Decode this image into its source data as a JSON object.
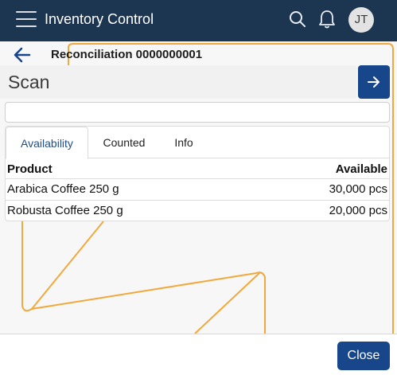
{
  "header": {
    "app_title": "Inventory Control",
    "avatar_initials": "JT",
    "background_color": "#1c3550"
  },
  "document": {
    "title": "Reconciliation 0000000001"
  },
  "scan": {
    "label": "Scan",
    "input_value": "",
    "go_icon": "arrow-right-icon"
  },
  "tabs": [
    {
      "label": "Availability",
      "active": true
    },
    {
      "label": "Counted",
      "active": false
    },
    {
      "label": "Info",
      "active": false
    }
  ],
  "table": {
    "columns": [
      "Product",
      "Available"
    ],
    "rows": [
      {
        "product": "Arabica Coffee 250 g",
        "available": "30,000 pcs"
      },
      {
        "product": "Robusta Coffee 250 g",
        "available": "20,000 pcs"
      }
    ]
  },
  "footer": {
    "close_label": "Close"
  },
  "colors": {
    "accent": "#17468b",
    "decor_line": "#f2a93b"
  },
  "icons": [
    "menu-icon",
    "search-icon",
    "bell-icon",
    "back-arrow-icon",
    "arrow-right-icon"
  ]
}
